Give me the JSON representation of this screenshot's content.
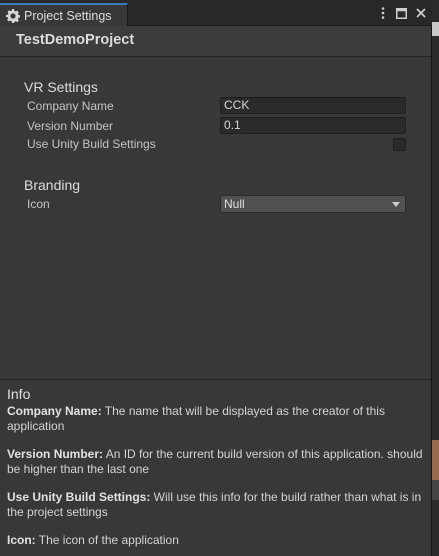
{
  "window": {
    "tab_title": "Project Settings",
    "tab_icon": "gear-icon",
    "accent_color": "#3a79bb"
  },
  "header": {
    "title": "TestDemoProject"
  },
  "vr_settings": {
    "title": "VR Settings",
    "company_name_label": "Company Name",
    "company_name_value": "CCK",
    "version_number_label": "Version Number",
    "version_number_value": "0.1",
    "use_unity_build_label": "Use Unity Build Settings",
    "use_unity_build_checked": false
  },
  "branding": {
    "title": "Branding",
    "icon_label": "Icon",
    "icon_value": "Null"
  },
  "info": {
    "title": "Info",
    "items": [
      {
        "term": "Company Name:",
        "desc": " The name that will be displayed as the creator of this application"
      },
      {
        "term": "Version Number:",
        "desc": " An ID for the current build version of this application. should be higher than the last one"
      },
      {
        "term": "Use Unity Build Settings:",
        "desc": " Will use this info for the build rather than what is in the project settings"
      },
      {
        "term": "Icon:",
        "desc": " The icon of the application"
      }
    ]
  }
}
